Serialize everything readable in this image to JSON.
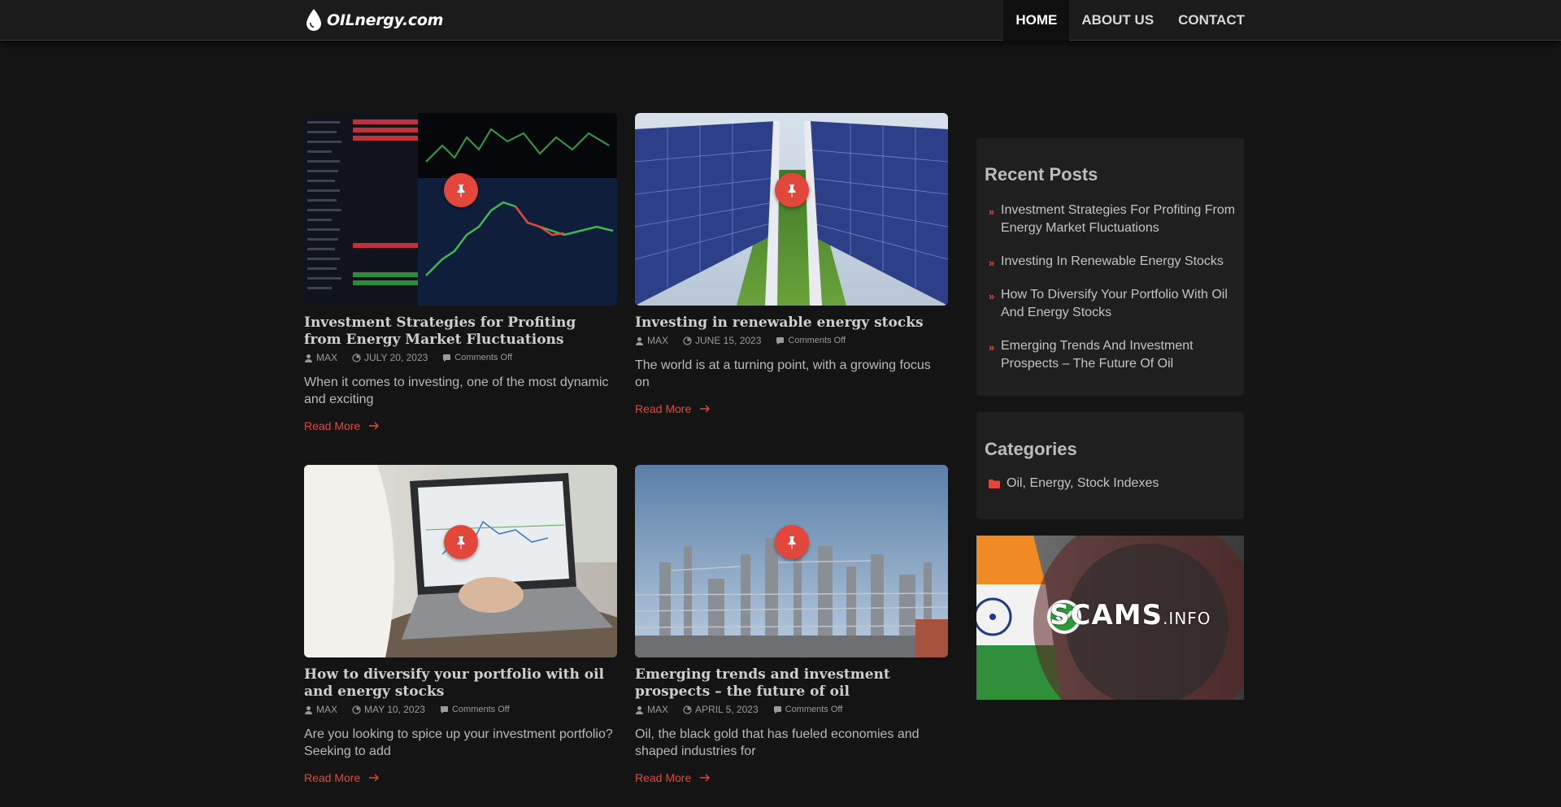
{
  "header": {
    "logo_text": "OILnergy.com",
    "nav": [
      {
        "label": "HOME",
        "active": true
      },
      {
        "label": "ABOUT US",
        "active": false
      },
      {
        "label": "CONTACT",
        "active": false
      }
    ]
  },
  "posts": [
    {
      "title": "Investment Strategies for Profiting from Energy Market Fluctuations",
      "author": "MAX",
      "date": "JULY 20, 2023",
      "comments": "Comments Off",
      "excerpt": "When it comes to investing, one of the most dynamic and exciting",
      "read_more": "Read More",
      "image": "stock-trading-screens"
    },
    {
      "title": "Investing in renewable energy stocks",
      "author": "MAX",
      "date": "JUNE 15, 2023",
      "comments": "Comments Off",
      "excerpt": "The world is at a turning point, with a growing focus on",
      "read_more": "Read More",
      "image": "solar-panels"
    },
    {
      "title": "How to diversify your portfolio with oil and energy stocks",
      "author": "MAX",
      "date": "MAY 10, 2023",
      "comments": "Comments Off",
      "excerpt": "Are you looking to spice up your investment portfolio? Seeking to add",
      "read_more": "Read More",
      "image": "laptop-charts"
    },
    {
      "title": "Emerging trends and investment prospects – the future of oil",
      "author": "MAX",
      "date": "APRIL 5, 2023",
      "comments": "Comments Off",
      "excerpt": "Oil, the black gold that has fueled economies and shaped industries for",
      "read_more": "Read More",
      "image": "oil-refinery"
    }
  ],
  "sidebar": {
    "recent_title": "Recent Posts",
    "recent_posts": [
      "Investment Strategies For Profiting From Energy Market Fluctuations",
      "Investing In Renewable Energy Stocks",
      "How To Diversify Your Portfolio With Oil And Energy Stocks",
      "Emerging Trends And Investment Prospects – The Future Of Oil"
    ],
    "categories_title": "Categories",
    "categories": [
      "Oil, Energy, Stock Indexes"
    ],
    "banner": {
      "brand": "SCAMS",
      "suffix": ".INFO"
    }
  },
  "colors": {
    "accent": "#e3473c",
    "background": "#141414",
    "header": "#1b1b1b",
    "widget": "#1f1f1f"
  },
  "icons": {
    "pin": "pushpin-icon",
    "author": "user-icon",
    "date": "clock-icon",
    "comments": "comment-icon",
    "read_more": "arrow-right-icon",
    "recent_bullet": "chevron-right-icon",
    "category": "folder-icon"
  }
}
